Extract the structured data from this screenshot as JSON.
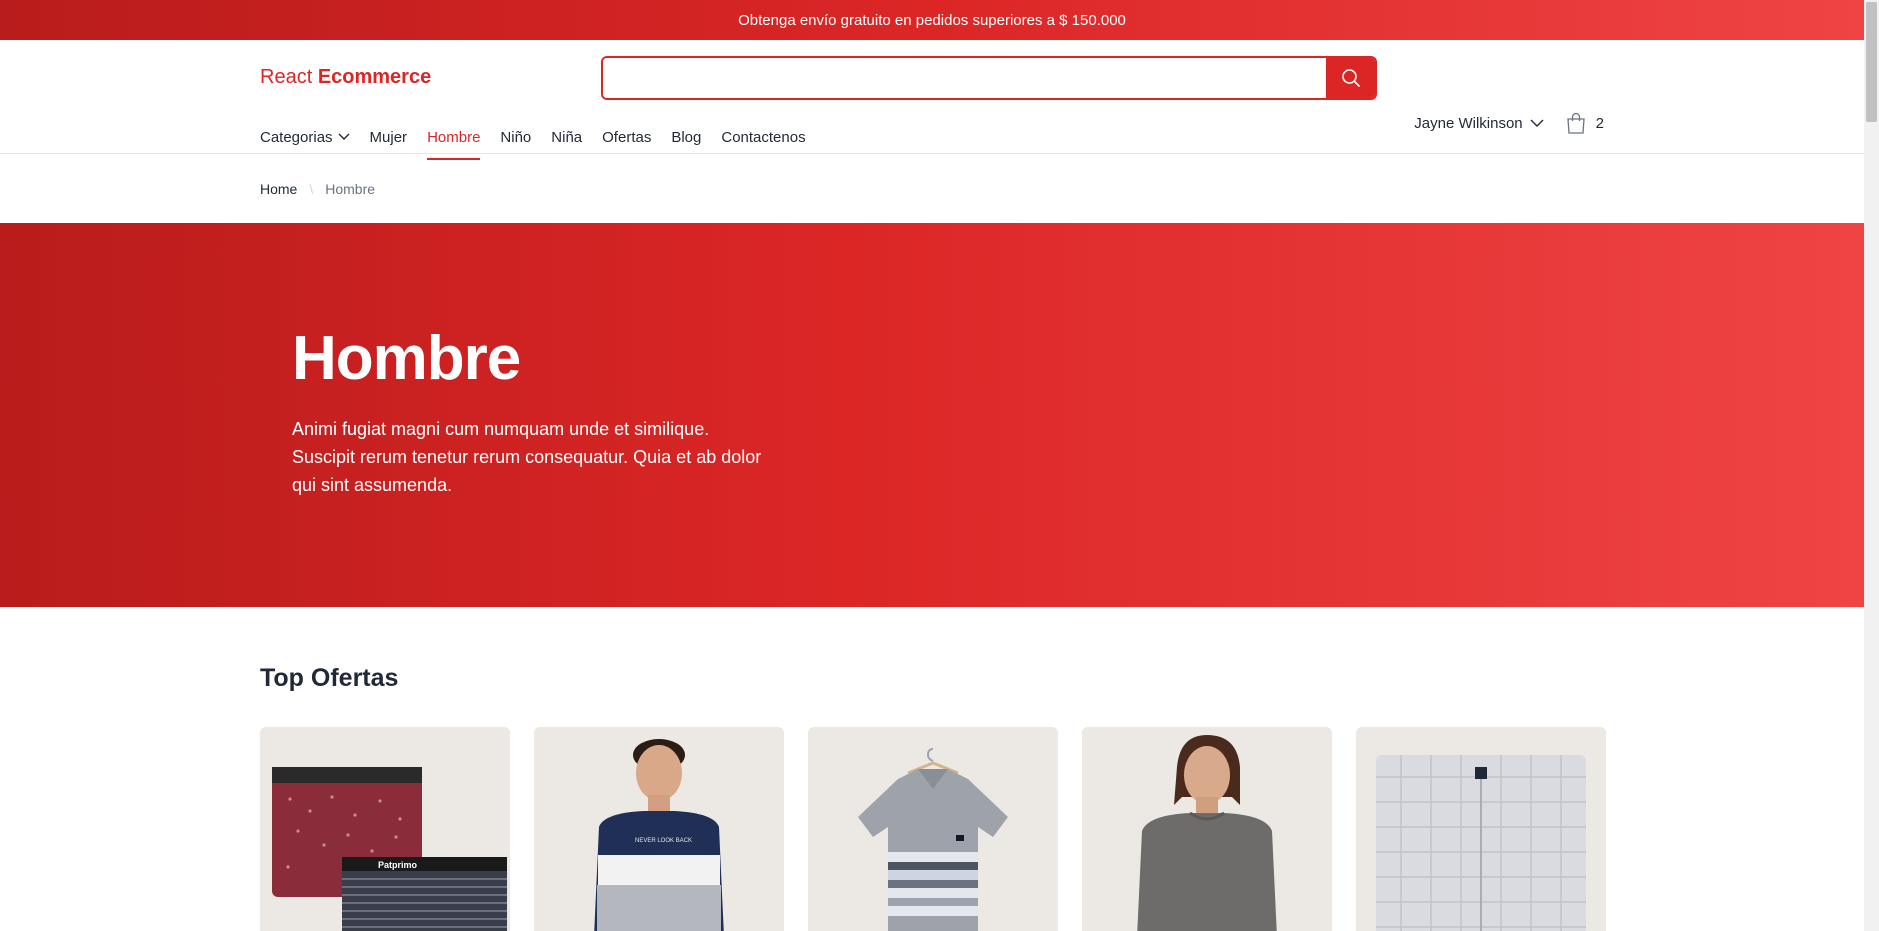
{
  "promo": {
    "text": "Obtenga envío gratuito en pedidos superiores a $ 150.000"
  },
  "header": {
    "logo_light": "React",
    "logo_bold": "Ecommerce",
    "search": {
      "value": "",
      "placeholder": ""
    },
    "nav": [
      {
        "label": "Categorias",
        "has_dropdown": true
      },
      {
        "label": "Mujer"
      },
      {
        "label": "Hombre",
        "active": true
      },
      {
        "label": "Niño"
      },
      {
        "label": "Niña"
      },
      {
        "label": "Ofertas"
      },
      {
        "label": "Blog"
      },
      {
        "label": "Contactenos"
      }
    ],
    "user_name": "Jayne Wilkinson",
    "cart_count": "2"
  },
  "breadcrumb": {
    "home": "Home",
    "separator": "\\",
    "current": "Hombre"
  },
  "hero": {
    "title": "Hombre",
    "description": "Animi fugiat magni cum numquam unde et similique. Suscipit rerum tenetur rerum consequatur. Quia et ab dolor qui sint assumenda."
  },
  "section": {
    "title": "Top Ofertas"
  },
  "products": [
    {
      "image": "patprimo-boxer-briefs",
      "brand_text": "Patprimo"
    },
    {
      "image": "man-navy-striped-tshirt",
      "shirt_text": "NEVER LOOK BACK"
    },
    {
      "image": "grey-striped-polo-on-hanger"
    },
    {
      "image": "man-grey-tshirt"
    },
    {
      "image": "plaid-grey-boxer-shorts"
    }
  ],
  "colors": {
    "accent": "#dc2626",
    "accent_dark": "#b91c1c",
    "accent_light": "#ef4444",
    "card_bg": "#ece8e3"
  }
}
